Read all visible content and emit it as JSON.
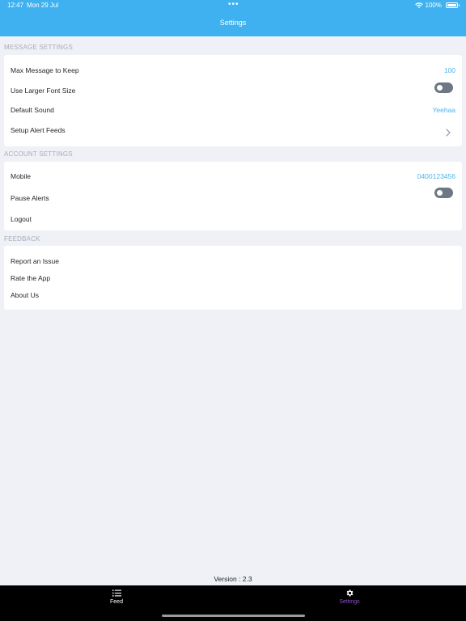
{
  "status_bar": {
    "time": "12:47",
    "date": "Mon 29 Jul",
    "battery": "100%"
  },
  "nav": {
    "title": "Settings"
  },
  "message_settings": {
    "header": "MESSAGE SETTINGS",
    "max_messages_label": "Max Message to Keep",
    "max_messages_value": "100",
    "larger_font_label": "Use Larger Font Size",
    "larger_font_on": false,
    "default_sound_label": "Default Sound",
    "default_sound_value": "Yeehaa",
    "alert_feeds_label": "Setup Alert Feeds"
  },
  "account_settings": {
    "header": "ACCOUNT SETTINGS",
    "mobile_label": "Mobile",
    "mobile_value": "0400123456",
    "pause_alerts_label": "Pause Alerts",
    "pause_alerts_on": false,
    "logout_label": "Logout"
  },
  "feedback": {
    "header": "FEEDBACK",
    "report_label": "Report an Issue",
    "rate_label": "Rate the App",
    "about_label": "About Us"
  },
  "version": "Version : 2.3",
  "tab_bar": {
    "feed_label": "Feed",
    "settings_label": "Settings"
  },
  "colors": {
    "header_bg": "#3fb1f0",
    "accent_value": "#4cb3ea",
    "tab_active": "#8c52c8",
    "tab_inactive": "#ffffff",
    "toggle_off": "#6e7785"
  }
}
